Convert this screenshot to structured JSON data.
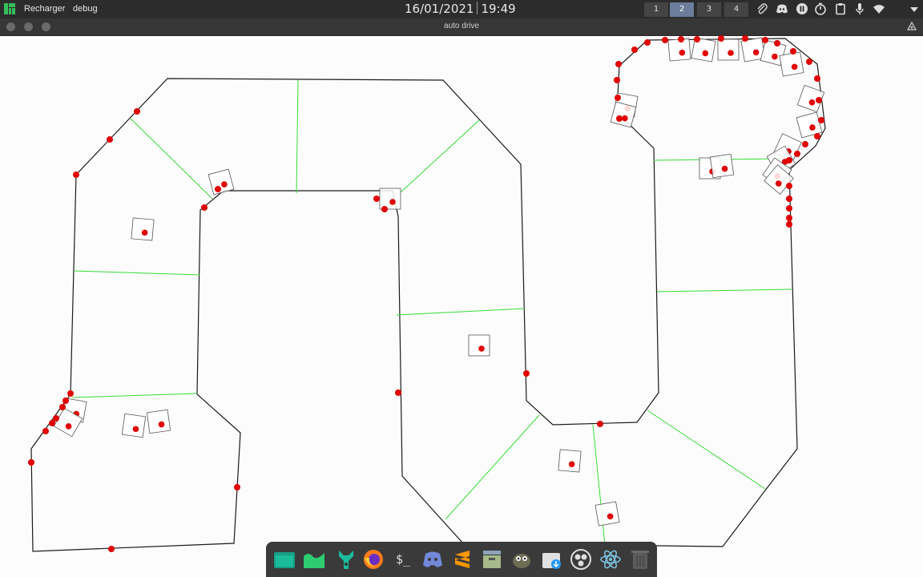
{
  "topbar": {
    "menu": [
      "Recharger",
      "debug"
    ],
    "date": "16/01/2021",
    "time": "19:49",
    "workspaces": [
      "1",
      "2",
      "3",
      "4"
    ],
    "active_workspace": "2",
    "tray_icons": [
      "paperclip-icon",
      "discord-icon",
      "pause-icon",
      "timer-icon",
      "clipboard-icon",
      "microphone-icon",
      "wifi-icon",
      "dropdown-icon"
    ]
  },
  "window": {
    "title": "auto drive",
    "buttons": [
      "close",
      "minimize",
      "maximize"
    ]
  },
  "dock": {
    "apps": [
      "files-icon",
      "wave-icon",
      "tools-icon",
      "firefox-icon",
      "terminal-icon",
      "discord-icon",
      "sublime-icon",
      "archive-icon",
      "gimp-icon",
      "downloads-icon",
      "obs-icon",
      "atom-icon",
      "trash-icon"
    ],
    "terminal_label": "$_"
  },
  "colors": {
    "track": "#1a1a1a",
    "checkpoint": "#33dd33",
    "agent_dot": "#e00000",
    "agent_box": "#555555"
  }
}
